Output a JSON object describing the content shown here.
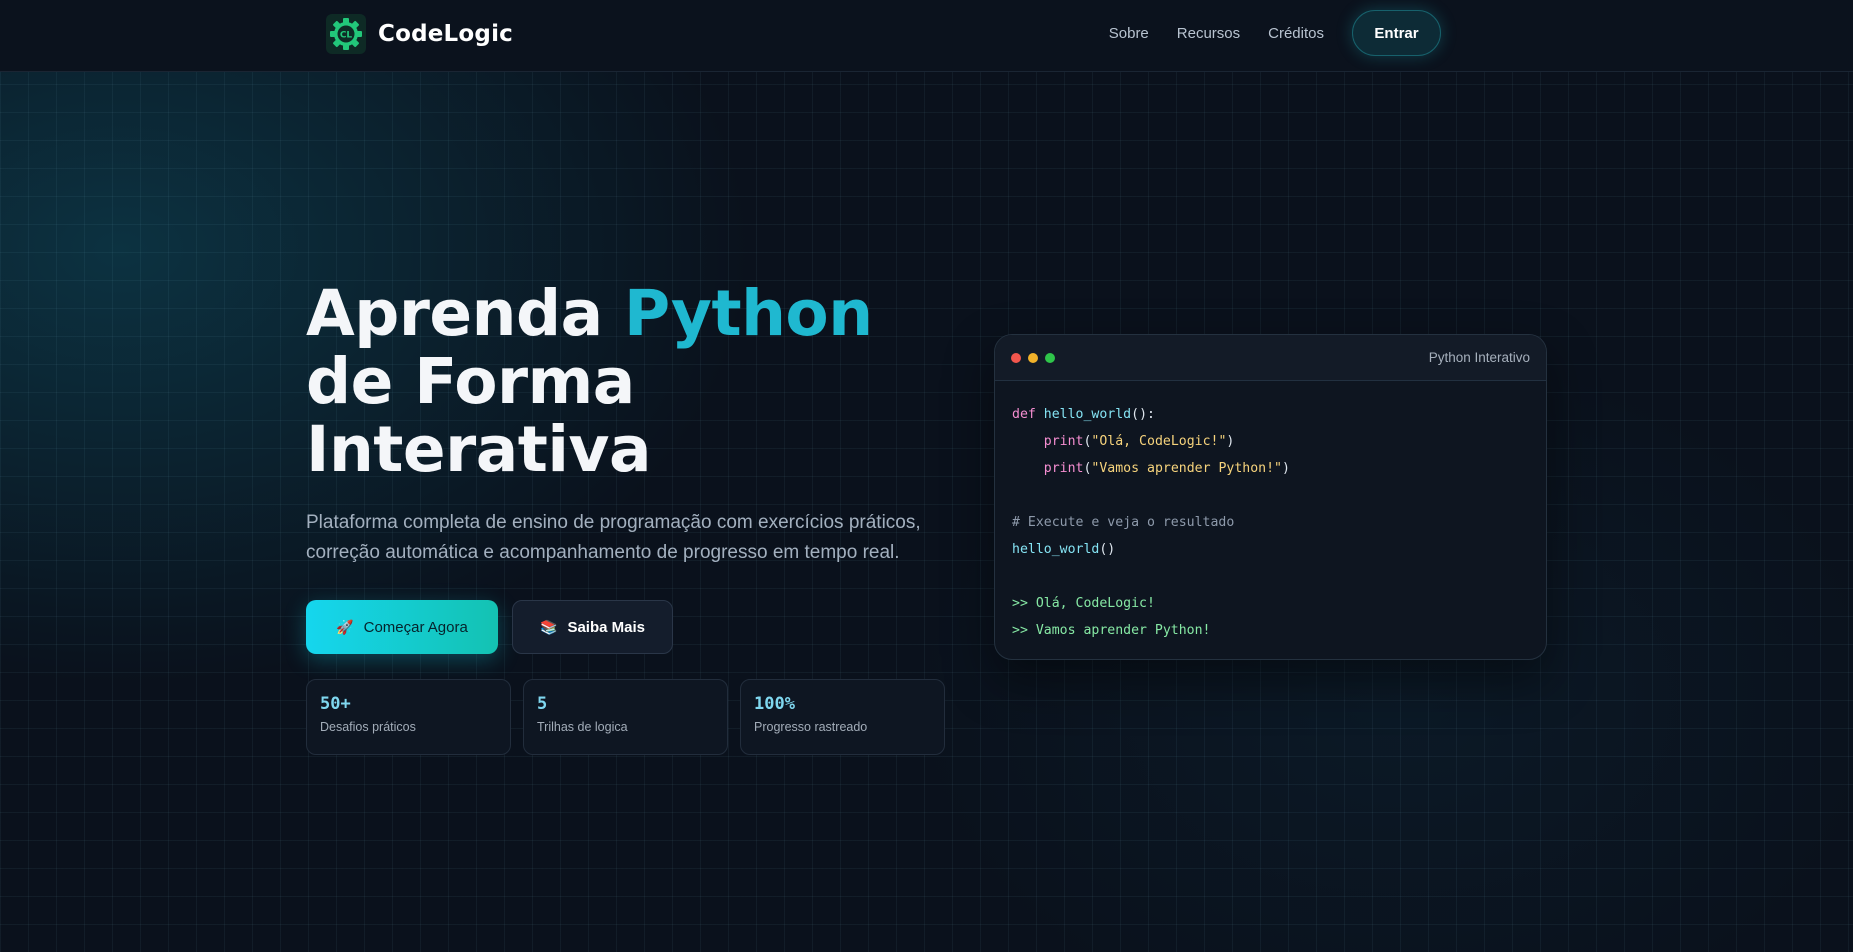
{
  "header": {
    "logo_text": "CL",
    "brand": "CodeLogic",
    "nav": [
      "Sobre",
      "Recursos",
      "Créditos"
    ],
    "cta": "Entrar"
  },
  "hero": {
    "title_part1": "Aprenda ",
    "title_accent": "Python",
    "title_line2": "de Forma Interativa",
    "subtitle": "Plataforma completa de ensino de programação com exercícios práticos, correção automática e acompanhamento de progresso em tempo real.",
    "primary_button": {
      "icon": "🚀",
      "label": "Começar Agora"
    },
    "secondary_button": {
      "icon": "📚",
      "label": "Saiba Mais"
    },
    "stats": [
      {
        "value": "50+",
        "label": "Desafios práticos"
      },
      {
        "value": "5",
        "label": "Trilhas de logica"
      },
      {
        "value": "100%",
        "label": "Progresso rastreado"
      }
    ]
  },
  "code_window": {
    "title": "Python Interativo",
    "code": {
      "kw_def": "def",
      "fn_name": "hello_world",
      "parens_colon": "():",
      "indent": "    ",
      "print": "print",
      "open_paren": "(",
      "close_paren": ")",
      "str1": "\"Olá, CodeLogic!\"",
      "str2": "\"Vamos aprender Python!\"",
      "comment": "# Execute e veja o resultado",
      "call_parens": "()",
      "output1": ">> Olá, CodeLogic!",
      "output2": ">> Vamos aprender Python!"
    }
  },
  "colors": {
    "accent": "#1fb8d0",
    "background": "#0a111c",
    "primary_gradient_start": "#15d6ee",
    "primary_gradient_end": "#14c2b2"
  }
}
